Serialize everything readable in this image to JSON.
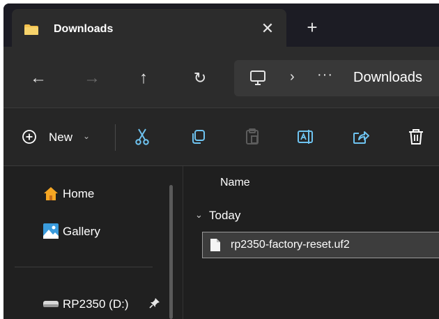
{
  "tab": {
    "title": "Downloads",
    "close_glyph": "✕",
    "new_tab_glyph": "+"
  },
  "nav": {
    "back_glyph": "←",
    "forward_glyph": "→",
    "up_glyph": "↑",
    "refresh_glyph": "↻",
    "address": {
      "separator": "›",
      "more": "···",
      "crumb": "Downloads"
    }
  },
  "command_bar": {
    "new_label": "New",
    "new_chevron": "⌄",
    "icons": [
      "cut-icon",
      "copy-icon",
      "paste-icon",
      "rename-icon",
      "share-icon",
      "delete-icon"
    ]
  },
  "sidebar": {
    "items": [
      {
        "label": "Home",
        "icon": "home-icon"
      },
      {
        "label": "Gallery",
        "icon": "gallery-icon"
      },
      {
        "label": "RP2350 (D:)",
        "icon": "drive-icon",
        "pinned": true
      }
    ]
  },
  "content": {
    "column_header": "Name",
    "group": {
      "chevron": "⌄",
      "label": "Today"
    },
    "files": [
      {
        "name": "rp2350-factory-reset.uf2",
        "selected": true
      }
    ]
  },
  "colors": {
    "window_bg": "#202020",
    "tab_active": "#2c2c2c",
    "folder_yellow": "#f2c14e",
    "home_orange": "#f5a623",
    "gallery_blue": "#3a9bdc",
    "selection": "#3d3d3d"
  }
}
